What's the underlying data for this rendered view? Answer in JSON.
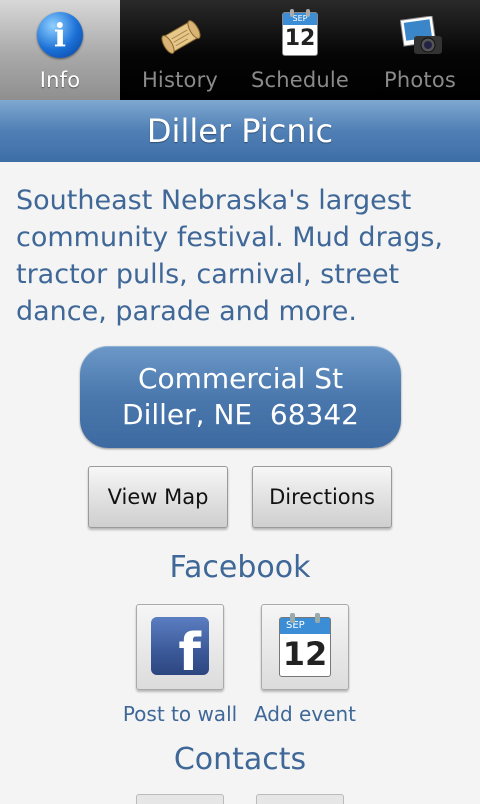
{
  "tabs": [
    {
      "label": "Info",
      "icon": "info-icon",
      "active": true
    },
    {
      "label": "History",
      "icon": "scroll-icon",
      "active": false
    },
    {
      "label": "Schedule",
      "icon": "calendar-icon",
      "active": false
    },
    {
      "label": "Photos",
      "icon": "camera-photo-icon",
      "active": false
    }
  ],
  "header": {
    "title": "Diller Picnic"
  },
  "description": "Southeast Nebraska's largest community festival. Mud drags, tractor pulls, carnival, street dance, parade and more.",
  "address": {
    "line1": "Commercial St",
    "line2": "Diller, NE  68342"
  },
  "buttons": {
    "view_map": "View Map",
    "directions": "Directions"
  },
  "facebook": {
    "title": "Facebook",
    "post_label": "Post to wall",
    "event_label": "Add event",
    "fb_glyph": "f",
    "calendar_month": "SEP",
    "calendar_day": "12"
  },
  "contacts": {
    "title": "Contacts"
  },
  "colors": {
    "accent_blue": "#3f6898",
    "header_blue": "#4f7fb5",
    "facebook_blue": "#3b5998"
  }
}
